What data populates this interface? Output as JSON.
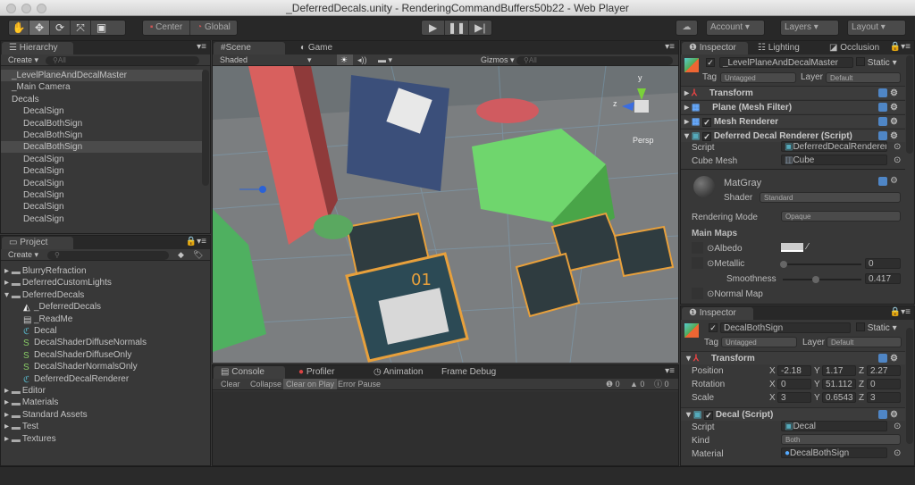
{
  "window": {
    "title": "_DeferredDecals.unity - RenderingCommandBuffers50b22 - Web Player"
  },
  "toolbar": {
    "tools": [
      "hand",
      "move",
      "rotate",
      "scale",
      "rect"
    ],
    "pivot": "Center",
    "space": "Global",
    "play": "play-icon",
    "pause": "pause-icon",
    "step": "step-icon",
    "account": "Account",
    "layers": "Layers",
    "layout": "Layout"
  },
  "hierarchy": {
    "tab": "Hierarchy",
    "create": "Create",
    "search_placeholder": "All",
    "items": [
      {
        "label": "_LevelPlaneAndDecalMaster",
        "indent": 0
      },
      {
        "label": "_Main Camera",
        "indent": 0
      },
      {
        "label": "Decals",
        "indent": 0
      },
      {
        "label": "DecalSign",
        "indent": 1
      },
      {
        "label": "DecalBothSign",
        "indent": 1
      },
      {
        "label": "DecalBothSign",
        "indent": 1
      },
      {
        "label": "DecalBothSign",
        "indent": 1,
        "selected": true
      },
      {
        "label": "DecalSign",
        "indent": 1
      },
      {
        "label": "DecalSign",
        "indent": 1
      },
      {
        "label": "DecalSign",
        "indent": 1
      },
      {
        "label": "DecalSign",
        "indent": 1
      },
      {
        "label": "DecalSign",
        "indent": 1
      },
      {
        "label": "DecalSign",
        "indent": 1
      }
    ]
  },
  "project": {
    "tab": "Project",
    "create": "Create",
    "items": [
      {
        "label": "BlurryRefraction",
        "type": "folder"
      },
      {
        "label": "DeferredCustomLights",
        "type": "folder"
      },
      {
        "label": "DeferredDecals",
        "type": "folder-open"
      },
      {
        "label": "_DeferredDecals",
        "type": "scene"
      },
      {
        "label": "_ReadMe",
        "type": "text"
      },
      {
        "label": "Decal",
        "type": "script"
      },
      {
        "label": "DecalShaderDiffuseNormals",
        "type": "shader"
      },
      {
        "label": "DecalShaderDiffuseOnly",
        "type": "shader"
      },
      {
        "label": "DecalShaderNormalsOnly",
        "type": "shader"
      },
      {
        "label": "DeferredDecalRenderer",
        "type": "script"
      },
      {
        "label": "Editor",
        "type": "folder"
      },
      {
        "label": "Materials",
        "type": "folder"
      },
      {
        "label": "Standard Assets",
        "type": "folder"
      },
      {
        "label": "Test",
        "type": "folder"
      },
      {
        "label": "Textures",
        "type": "folder"
      }
    ]
  },
  "scene": {
    "tab_scene": "Scene",
    "tab_game": "Game",
    "shading": "Shaded",
    "mode2d": "2D",
    "gizmos": "Gizmos",
    "search_placeholder": "All",
    "persp": "Persp",
    "axis_y": "y",
    "axis_z": "z",
    "decal_label": "01"
  },
  "console": {
    "tabs": [
      "Console",
      "Profiler",
      "Animation",
      "Frame Debug"
    ],
    "buttons": [
      "Clear",
      "Collapse",
      "Clear on Play",
      "Error Pause"
    ],
    "counts": {
      "info": "0",
      "warn": "0",
      "error": "0"
    }
  },
  "inspector1": {
    "tabs": [
      "Inspector",
      "Lighting",
      "Occlusion"
    ],
    "name": "_LevelPlaneAndDecalMaster",
    "static": "Static",
    "tag_label": "Tag",
    "tag": "Untagged",
    "layer_label": "Layer",
    "layer": "Default",
    "components": [
      "Transform",
      "Plane (Mesh Filter)",
      "Mesh Renderer",
      "Deferred Decal Renderer (Script)"
    ],
    "script_label": "Script",
    "script": "DeferredDecalRenderer",
    "cube_mesh_label": "Cube Mesh",
    "cube_mesh": "Cube",
    "material": "MatGray",
    "shader_label": "Shader",
    "shader": "Standard",
    "rendering_mode_label": "Rendering Mode",
    "rendering_mode": "Opaque",
    "main_maps": "Main Maps",
    "albedo": "Albedo",
    "metallic": "Metallic",
    "metallic_value": "0",
    "smoothness": "Smoothness",
    "smoothness_value": "0.417",
    "normal_map": "Normal Map"
  },
  "inspector2": {
    "tab": "Inspector",
    "name": "DecalBothSign",
    "static": "Static",
    "tag_label": "Tag",
    "tag": "Untagged",
    "layer_label": "Layer",
    "layer": "Default",
    "transform": "Transform",
    "position_label": "Position",
    "position": {
      "x": "-2.18",
      "y": "1.17",
      "z": "2.27"
    },
    "rotation_label": "Rotation",
    "rotation": {
      "x": "0",
      "y": "51.112",
      "z": "0"
    },
    "scale_label": "Scale",
    "scale": {
      "x": "3",
      "y": "0.6543",
      "z": "3"
    },
    "decal_component": "Decal (Script)",
    "script_label": "Script",
    "script": "Decal",
    "kind_label": "Kind",
    "kind": "Both",
    "material_label": "Material",
    "material": "DecalBothSign"
  }
}
